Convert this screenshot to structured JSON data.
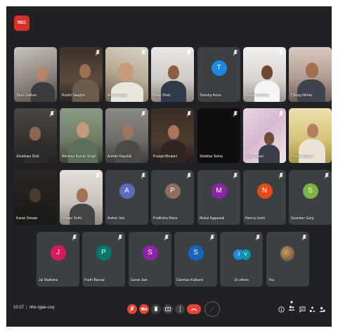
{
  "rec_label": "REC",
  "row1": [
    {
      "name": "Tanvi Jadhav"
    },
    {
      "name": "Rushil Sanghvi"
    },
    {
      "name": "Aryan Gupta"
    },
    {
      "name": "Nirav Shah"
    },
    {
      "name": "Tanishq Arora",
      "initial": "T",
      "color": "#1e88e5"
    },
    {
      "name": "Rohan Sharma"
    },
    {
      "name": "Chirag Mehta"
    }
  ],
  "row2": [
    {
      "name": "Shubham Dixit"
    },
    {
      "name": "Abhinav Kumar Singh"
    },
    {
      "name": "Ashish Kaushik"
    },
    {
      "name": "Pranjal Bhutani"
    },
    {
      "name": "Shekhar Sinha"
    },
    {
      "name": "Anya Tiwari"
    },
    {
      "name": "Dinesh Rawat"
    }
  ],
  "row3": [
    {
      "name": "Karan Dewan"
    },
    {
      "name": "Vivaan Sethi"
    },
    {
      "name": "Aniket Jain",
      "initial": "A",
      "color": "#5c6bc0"
    },
    {
      "name": "Pratiksha Mane",
      "initial": "P",
      "color": "#8d6e63"
    },
    {
      "name": "Mukul Aggarwal",
      "initial": "M",
      "color": "#8e24aa"
    },
    {
      "name": "Neeraj Joshi",
      "initial": "N",
      "color": "#e64a19"
    },
    {
      "name": "Spandan Garg",
      "initial": "S",
      "color": "#7cb342"
    }
  ],
  "row4": [
    {
      "name": "Jai Malhotra",
      "initial": "J",
      "color": "#d81b60"
    },
    {
      "name": "Parth Bansal",
      "initial": "P",
      "color": "#00796b"
    },
    {
      "name": "Sanat Jain",
      "initial": "S",
      "color": "#8e24aa"
    },
    {
      "name": "Darshan Kulkarni",
      "initial": "S",
      "color": "#1565c0"
    },
    {
      "name": "16 others",
      "initials": [
        "J",
        "V"
      ],
      "colors": [
        "#1e88e5",
        "#0097a7"
      ]
    },
    {
      "name": "You"
    }
  ],
  "bottom": {
    "time": "10:27",
    "meeting_code": "nhe-rgae-csq"
  },
  "colors": {
    "end_call": "#ea4335",
    "muted": "#ea4335",
    "bar_button": "#3c4043"
  }
}
